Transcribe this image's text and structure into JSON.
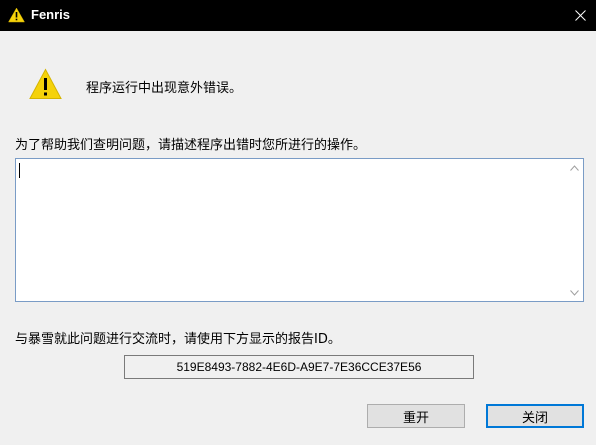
{
  "window": {
    "title": "Fenris",
    "title_icon": "warning-icon",
    "close_icon": "close-icon"
  },
  "dialog": {
    "message": "程序运行中出现意外错误。",
    "prompt": "为了帮助我们查明问题，请描述程序出错时您所进行的操作。",
    "description_value": "",
    "report_label": "与暴雪就此问题进行交流时，请使用下方显示的报告ID。",
    "report_id": "519E8493-7882-4E6D-A9E7-7E36CCE37E56"
  },
  "buttons": {
    "restart_label": "重开",
    "close_label": "关闭"
  },
  "colors": {
    "titlebar": "#000000",
    "warning_yellow": "#f5d20a",
    "accent": "#0078d7"
  }
}
